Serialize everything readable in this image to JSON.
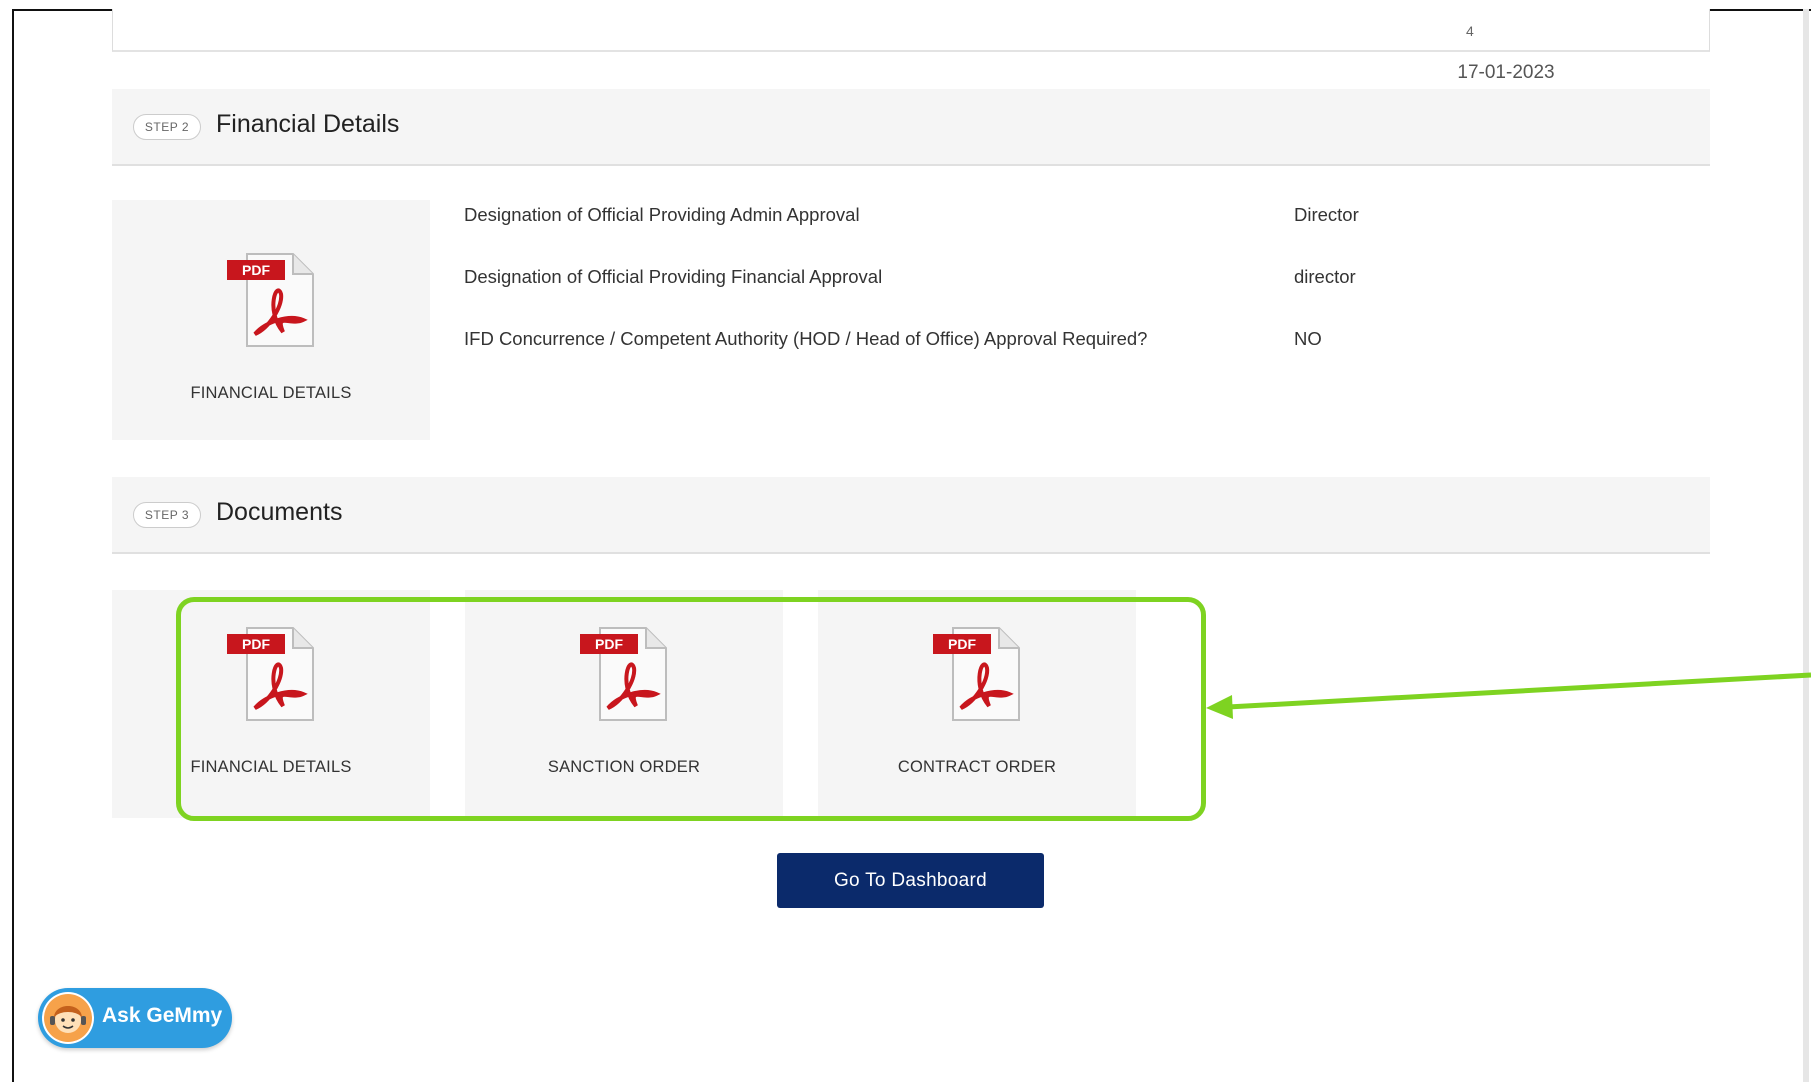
{
  "top_row": {
    "number": "4",
    "date": "17-01-2023"
  },
  "step2": {
    "pill": "STEP 2",
    "title": "Financial Details",
    "card_label": "FINANCIAL DETAILS",
    "rows": [
      {
        "label": "Designation of Official Providing Admin Approval",
        "value": "Director"
      },
      {
        "label": "Designation of Official Providing Financial Approval",
        "value": "director"
      },
      {
        "label": "IFD Concurrence / Competent Authority (HOD / Head of Office) Approval Required?",
        "value": "NO"
      }
    ]
  },
  "step3": {
    "pill": "STEP 3",
    "title": "Documents",
    "documents": [
      {
        "label": "FINANCIAL DETAILS"
      },
      {
        "label": "SANCTION ORDER"
      },
      {
        "label": "CONTRACT ORDER"
      }
    ]
  },
  "icon_text": {
    "pdf": "PDF"
  },
  "dashboard_button": "Go To Dashboard",
  "ask_widget": {
    "label": "Ask GeMmy"
  },
  "colors": {
    "highlight": "#7ed321",
    "button_bg": "#0b2a6b",
    "widget_bg": "#2f9de0",
    "pdf_red": "#c8161d"
  },
  "icons": [
    "pdf-file-icon",
    "arrow-pointer",
    "assistant-avatar-icon"
  ]
}
